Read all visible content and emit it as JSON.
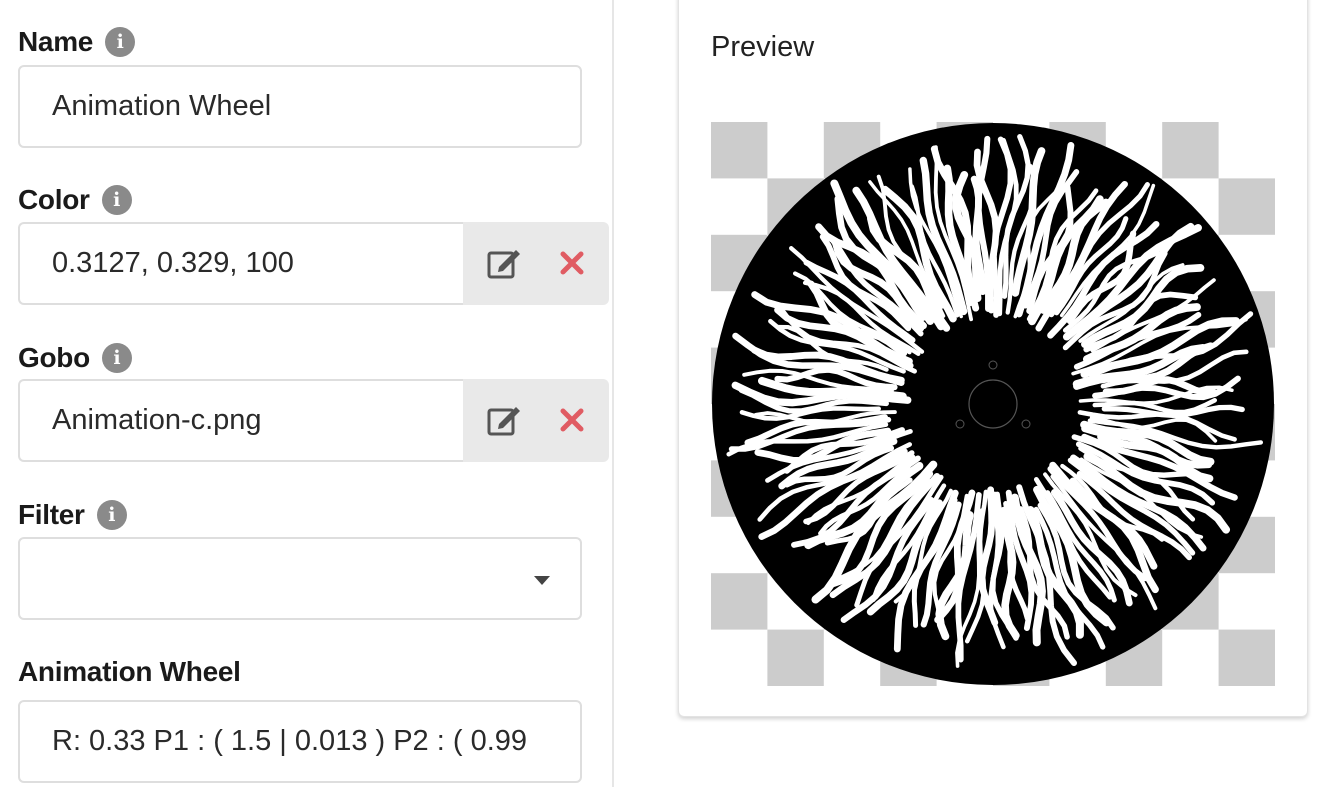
{
  "form": {
    "name": {
      "label": "Name",
      "value": "Animation Wheel"
    },
    "color": {
      "label": "Color",
      "value": "0.3127, 0.329, 100"
    },
    "gobo": {
      "label": "Gobo",
      "value": "Animation-c.png"
    },
    "filter": {
      "label": "Filter",
      "value": ""
    },
    "animation_wheel": {
      "label": "Animation Wheel",
      "value": "R: 0.33  P1 : ( 1.5 | 0.013 )  P2 : ( 0.99"
    }
  },
  "preview": {
    "title": "Preview"
  },
  "icons": {
    "info": "info-icon",
    "edit": "edit-icon",
    "remove": "close-icon",
    "dropdown": "chevron-down-icon"
  },
  "colors": {
    "info_icon": "#8a8a8a",
    "remove_icon": "#e05c63",
    "addon_bg": "#e9e9e9",
    "checker": "#cccccc",
    "wheel": "#000000"
  }
}
